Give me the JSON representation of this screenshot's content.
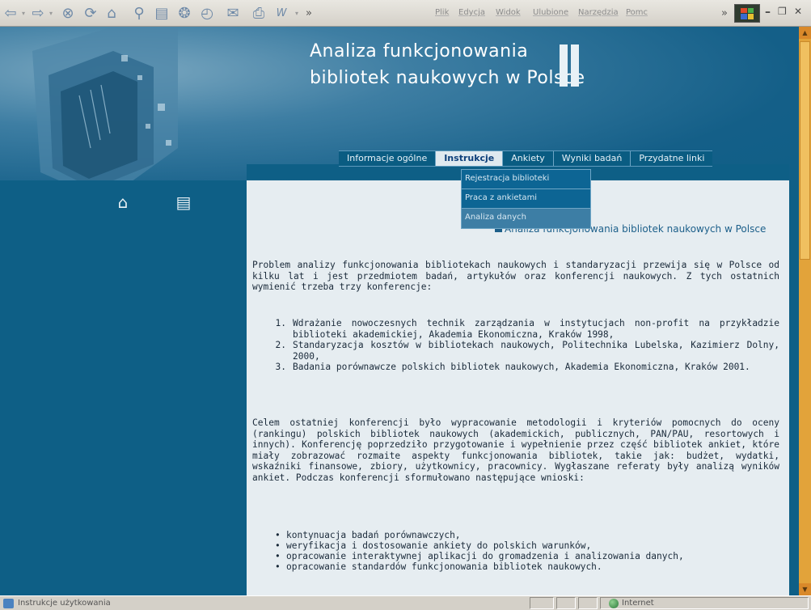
{
  "browser": {
    "nav_icons": [
      {
        "name": "back-icon",
        "glyph": "⇦"
      },
      {
        "name": "forward-icon",
        "glyph": "⇨"
      },
      {
        "name": "stop-icon",
        "glyph": "⊗"
      },
      {
        "name": "refresh-icon",
        "glyph": "⟳"
      },
      {
        "name": "home-icon",
        "glyph": "⌂"
      },
      {
        "name": "search-icon",
        "glyph": "⚲"
      },
      {
        "name": "favorites-icon",
        "glyph": "▤"
      },
      {
        "name": "media-icon",
        "glyph": "❂"
      },
      {
        "name": "history-icon",
        "glyph": "◴"
      },
      {
        "name": "mail-icon",
        "glyph": "✉"
      },
      {
        "name": "print-icon",
        "glyph": "⎙"
      },
      {
        "name": "edit-icon",
        "glyph": "W"
      }
    ],
    "more_glyph": "»",
    "menu": [
      "Plik",
      "Edycja",
      "Widok",
      "Ulubione",
      "Narzędzia",
      "Pomc"
    ],
    "window_buttons": {
      "minimize": "–",
      "restore": "❐",
      "close": "✕"
    }
  },
  "site": {
    "title_line1": "Analiza funkcjonowania",
    "title_line2": "bibliotek naukowych w Polsce",
    "side_icons": [
      {
        "name": "home-icon",
        "glyph": "⌂"
      },
      {
        "name": "document-icon",
        "glyph": "▤"
      }
    ]
  },
  "nav": {
    "items": [
      "Informacje ogólne",
      "Instrukcje",
      "Ankiety",
      "Wyniki badań",
      "Przydatne linki"
    ],
    "active_index": 1,
    "dropdown": [
      "Rejestracja biblioteki",
      "Praca z ankietami",
      "Analiza danych"
    ]
  },
  "content": {
    "heading": "Analiza funkcjonowania bibliotek naukowych w Polsce",
    "para1": "Problem analizy funkcjonowania bibliotekach naukowych i standaryzacji przewija się w Polsce od kilku lat i jest przedmiotem badań, artykułów oraz konferencji naukowych. Z tych ostatnich wymienić trzeba trzy konferencje:",
    "ordered_list": [
      {
        "num": "1.",
        "text": "Wdrażanie nowoczesnych technik zarządzania w instytucjach non-profit na przykładzie biblioteki akademickiej, Akademia Ekonomiczna, Kraków 1998,"
      },
      {
        "num": "2.",
        "text": "Standaryzacja kosztów w bibliotekach naukowych, Politechnika Lubelska, Kazimierz Dolny, 2000,"
      },
      {
        "num": "3.",
        "text": "Badania porównawcze polskich bibliotek naukowych, Akademia Ekonomiczna, Kraków 2001."
      }
    ],
    "para2": "Celem ostatniej konferencji było wypracowanie metodologii i kryteriów pomocnych do oceny (rankingu) polskich bibliotek naukowych (akademickich, publicznych, PAN/PAU, resortowych i innych). Konferencję poprzedziło przygotowanie i wypełnienie przez część bibliotek ankiet, które miały zobrazować rozmaite aspekty funkcjonowania bibliotek, takie jak: budżet, wydatki, wskaźniki finansowe, zbiory, użytkownicy, pracownicy. Wygłaszane referaty były analizą wyników ankiet. Podczas konferencji sformułowano następujące wnioski:",
    "bullet_list": [
      "kontynuacja badań porównawczych,",
      "weryfikacja i dostosowanie ankiety do polskich warunków,",
      "opracowanie interaktywnej aplikacji do gromadzenia i analizowania danych,",
      "opracowanie standardów funkcjonowania bibliotek naukowych."
    ],
    "bullet_glyph": "•"
  },
  "statusbar": {
    "text": "Instrukcje użytkowania",
    "zone": "Internet"
  },
  "colors": {
    "page_blue": "#0e5f86",
    "content_bg": "#e6edf1",
    "scrollbar": "#e2a33a",
    "heading_blue": "#1c5f8a"
  }
}
